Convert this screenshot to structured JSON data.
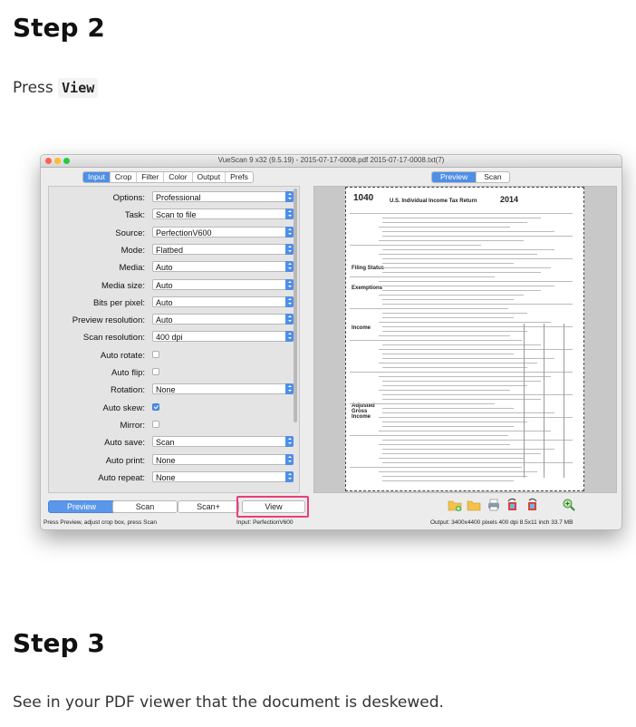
{
  "step2": {
    "heading": "Step 2",
    "press": "Press",
    "view_code": "View"
  },
  "window": {
    "title": "VueScan 9 x32 (9.5.19) - 2015-07-17-0008.pdf 2015-07-17-0008.txt(7)",
    "left_tabs": [
      "Input",
      "Crop",
      "Filter",
      "Color",
      "Output",
      "Prefs"
    ],
    "right_tabs": [
      "Preview",
      "Scan"
    ],
    "settings": [
      {
        "label": "Options:",
        "type": "select",
        "value": "Professional"
      },
      {
        "label": "Task:",
        "type": "select",
        "value": "Scan to file"
      },
      {
        "label": "Source:",
        "type": "select",
        "value": "PerfectionV600"
      },
      {
        "label": "Mode:",
        "type": "select",
        "value": "Flatbed"
      },
      {
        "label": "Media:",
        "type": "select",
        "value": "Auto"
      },
      {
        "label": "Media size:",
        "type": "select",
        "value": "Auto"
      },
      {
        "label": "Bits per pixel:",
        "type": "select",
        "value": "Auto"
      },
      {
        "label": "Preview resolution:",
        "type": "select",
        "value": "Auto"
      },
      {
        "label": "Scan resolution:",
        "type": "select",
        "value": "400 dpi"
      },
      {
        "label": "Auto rotate:",
        "type": "check",
        "checked": false
      },
      {
        "label": "Auto flip:",
        "type": "check",
        "checked": false
      },
      {
        "label": "Rotation:",
        "type": "select",
        "value": "None"
      },
      {
        "label": "Auto skew:",
        "type": "check",
        "checked": true
      },
      {
        "label": "Mirror:",
        "type": "check",
        "checked": false
      },
      {
        "label": "Auto save:",
        "type": "select",
        "value": "Scan"
      },
      {
        "label": "Auto print:",
        "type": "select",
        "value": "None"
      },
      {
        "label": "Auto repeat:",
        "type": "select",
        "value": "None"
      }
    ],
    "buttons": {
      "preview": "Preview",
      "scan": "Scan",
      "scan_plus": "Scan+",
      "view": "View"
    },
    "status": {
      "left": "Press Preview, adjust crop box, press Scan",
      "mid": "Input: PerfectionV600",
      "right": "Output: 3400x4400 pixels 400 dpi 8.5x11 inch 33.7 MB"
    },
    "document": {
      "form_number": "1040",
      "form_title": "U.S. Individual Income Tax Return",
      "year": "2014",
      "sections": [
        "Filing Status",
        "Exemptions",
        "Income",
        "Adjusted Gross Income"
      ]
    }
  },
  "step3": {
    "heading": "Step 3",
    "text": "See in your PDF viewer that the document is deskewed."
  }
}
